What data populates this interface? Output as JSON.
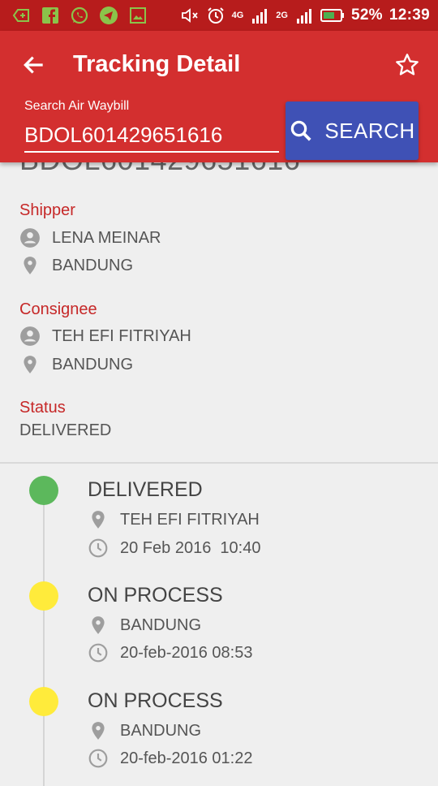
{
  "status_bar": {
    "left_icons": [
      "notification-add-icon",
      "facebook-icon",
      "whatsapp-icon",
      "telegram-icon",
      "image-icon"
    ],
    "network_1": "4G",
    "network_2": "2G",
    "battery": "52%",
    "time": "12:39"
  },
  "app_bar": {
    "title": "Tracking Detail",
    "search_label": "Search Air Waybill",
    "waybill_value": "BDOL601429651616",
    "search_button": "SEARCH"
  },
  "ghost_waybill": "BDOL601429651616",
  "shipper": {
    "title": "Shipper",
    "name": "LENA MEINAR",
    "city": "BANDUNG"
  },
  "consignee": {
    "title": "Consignee",
    "name": "TEH EFI FITRIYAH",
    "city": "BANDUNG"
  },
  "status": {
    "title": "Status",
    "value": "DELIVERED"
  },
  "events": [
    {
      "status": "DELIVERED",
      "location": "TEH EFI FITRIYAH",
      "time": "20 Feb 2016  10:40",
      "color": "#5cb85c"
    },
    {
      "status": "ON PROCESS",
      "location": "BANDUNG",
      "time": "20-feb-2016 08:53",
      "color": "#ffeb3b"
    },
    {
      "status": "ON PROCESS",
      "location": "BANDUNG",
      "time": "20-feb-2016 01:22",
      "color": "#ffeb3b"
    }
  ],
  "colors": {
    "status_bar": "#b71c1c",
    "app_bar": "#d32f2f",
    "search_button": "#3f51b5",
    "section_title": "#c62828"
  }
}
